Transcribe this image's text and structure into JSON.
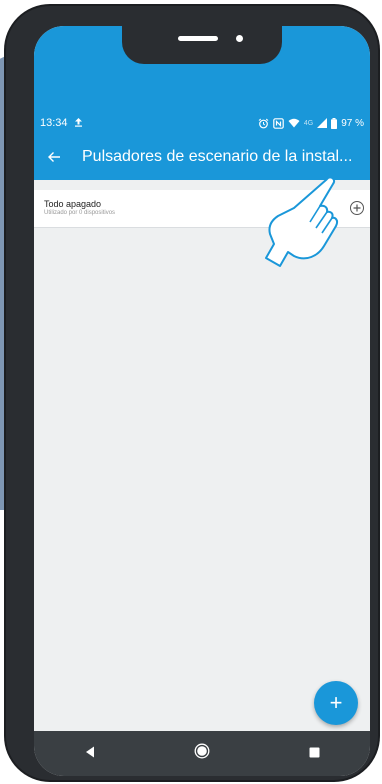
{
  "status_bar": {
    "time": "13:34",
    "battery": "97 %",
    "network": "4G"
  },
  "app_bar": {
    "title": "Pulsadores de escenario de la instal...",
    "back_icon": "arrow-left-icon"
  },
  "list": {
    "items": [
      {
        "title": "Todo apagado",
        "subtitle": "Utilizado por 0 dispositivos",
        "action_icon": "add-circle-icon"
      }
    ]
  },
  "fab": {
    "label": "+"
  },
  "nav": {
    "back_icon": "triangle-back-icon",
    "home_icon": "circle-home-icon",
    "recents_icon": "square-recents-icon"
  },
  "colors": {
    "primary": "#1a97d9",
    "phone_frame": "#2a2d31",
    "background": "#eef0f1",
    "nav_bar": "#3a3f43",
    "hand_outline": "#1a97d9"
  }
}
